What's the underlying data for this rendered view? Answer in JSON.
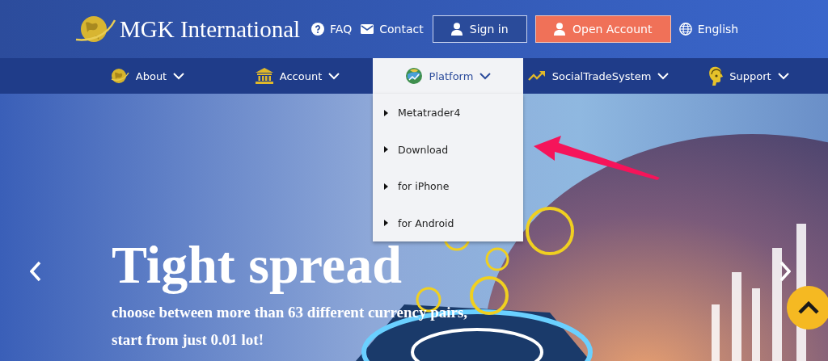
{
  "header": {
    "logo_text": "MGK International",
    "links": [
      {
        "kind": "faq",
        "label": "FAQ"
      },
      {
        "kind": "contact",
        "label": "Contact"
      }
    ],
    "buttons": [
      {
        "kind": "outline",
        "label": "Sign in"
      },
      {
        "kind": "primary",
        "label": "Open Account"
      }
    ],
    "language": "English"
  },
  "nav": {
    "items": [
      {
        "label": "About",
        "selected": false
      },
      {
        "label": "Account",
        "selected": false
      },
      {
        "label": "Platform",
        "selected": true
      },
      {
        "label": "SocialTradeSystem",
        "selected": false
      },
      {
        "label": "Support",
        "selected": false
      }
    ],
    "dropdown": [
      "Metatrader4",
      "Download",
      "for iPhone",
      "for Android"
    ]
  },
  "hero": {
    "title": "Tight spread",
    "subtitle": [
      "choose between more than 63 different currency pairs,",
      "start from just 0.01 lot!"
    ]
  }
}
